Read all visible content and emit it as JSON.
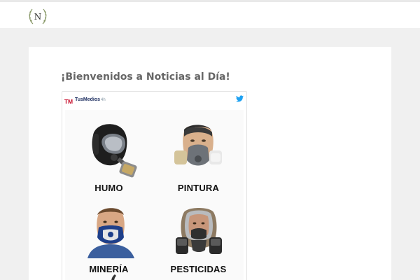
{
  "site": {
    "logo_letter": "N",
    "welcome_text": "¡Bienvenidos a Noticias al Día!"
  },
  "tweet": {
    "account_name": "TusMedios",
    "time": "4h",
    "logo_text": "TM",
    "icon": "twitter-bird-icon",
    "items": [
      {
        "caption": "HUMO",
        "icon": "full-face-gas-mask-icon"
      },
      {
        "caption": "PINTURA",
        "icon": "half-face-respirator-icon"
      },
      {
        "caption": "MINERÍA",
        "icon": "dust-mask-icon"
      },
      {
        "caption": "PESTICIDAS",
        "icon": "full-face-respirator-icon"
      }
    ]
  },
  "colors": {
    "page_bg": "#f0f0f0",
    "card_bg": "#ffffff",
    "twitter_blue": "#1da1f2",
    "logo_red": "#c8102e"
  }
}
